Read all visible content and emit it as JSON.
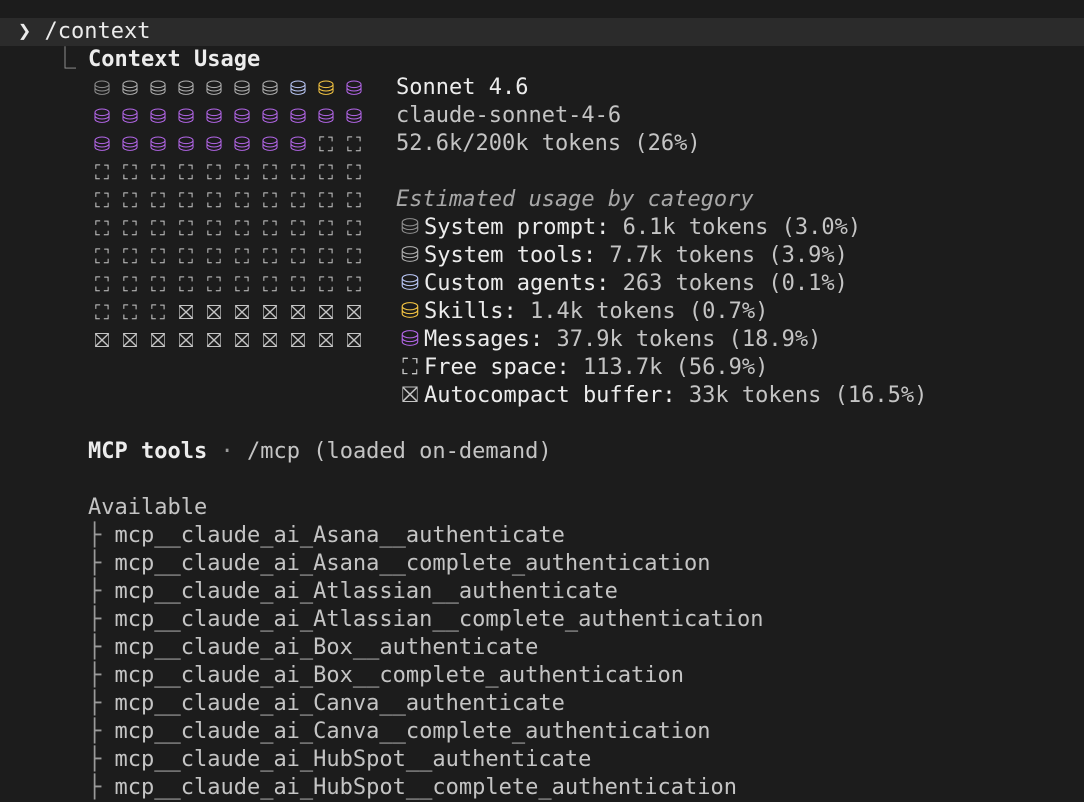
{
  "prompt": {
    "chevron": "❯",
    "command": "/context"
  },
  "panel": {
    "corner": "⎿",
    "title": "Context Usage"
  },
  "icons": {
    "system": "⛁",
    "free": "⛶",
    "buffer": "⛝",
    "names": {
      "system_prompt": "database-icon",
      "system_tools": "database-icon",
      "custom_agents": "database-icon",
      "skills": "database-icon",
      "messages": "database-icon",
      "free_space": "dashed-square-icon",
      "autocompact_buffer": "crossed-square-icon"
    }
  },
  "colors": {
    "system_prompt": "#8e8e8e",
    "system_tools": "#b0b0b0",
    "custom_agents": "#b9c6f5",
    "skills": "#f5c542",
    "messages": "#b366e8",
    "free_space": "#c4c4c4",
    "autocompact_buffer": "#c4c4c4"
  },
  "grid_rows": [
    [
      "system_prompt",
      "system_tools",
      "system_tools",
      "system_tools",
      "system_tools",
      "system_tools",
      "system_tools",
      "custom_agents",
      "skills",
      "messages"
    ],
    [
      "messages",
      "messages",
      "messages",
      "messages",
      "messages",
      "messages",
      "messages",
      "messages",
      "messages",
      "messages"
    ],
    [
      "messages",
      "messages",
      "messages",
      "messages",
      "messages",
      "messages",
      "messages",
      "messages",
      "free_space",
      "free_space"
    ],
    [
      "free_space",
      "free_space",
      "free_space",
      "free_space",
      "free_space",
      "free_space",
      "free_space",
      "free_space",
      "free_space",
      "free_space"
    ],
    [
      "free_space",
      "free_space",
      "free_space",
      "free_space",
      "free_space",
      "free_space",
      "free_space",
      "free_space",
      "free_space",
      "free_space"
    ],
    [
      "free_space",
      "free_space",
      "free_space",
      "free_space",
      "free_space",
      "free_space",
      "free_space",
      "free_space",
      "free_space",
      "free_space"
    ],
    [
      "free_space",
      "free_space",
      "free_space",
      "free_space",
      "free_space",
      "free_space",
      "free_space",
      "free_space",
      "free_space",
      "free_space"
    ],
    [
      "free_space",
      "free_space",
      "free_space",
      "free_space",
      "free_space",
      "free_space",
      "free_space",
      "free_space",
      "free_space",
      "free_space"
    ],
    [
      "free_space",
      "free_space",
      "free_space",
      "autocompact_buffer",
      "autocompact_buffer",
      "autocompact_buffer",
      "autocompact_buffer",
      "autocompact_buffer",
      "autocompact_buffer",
      "autocompact_buffer"
    ],
    [
      "autocompact_buffer",
      "autocompact_buffer",
      "autocompact_buffer",
      "autocompact_buffer",
      "autocompact_buffer",
      "autocompact_buffer",
      "autocompact_buffer",
      "autocompact_buffer",
      "autocompact_buffer",
      "autocompact_buffer"
    ]
  ],
  "model": {
    "name": "Sonnet 4.6",
    "id": "claude-sonnet-4-6",
    "tokens": "52.6k/200k tokens (26%)"
  },
  "estimated": {
    "heading": "Estimated usage by category",
    "items": [
      {
        "key": "system_prompt",
        "label": "System prompt:",
        "value": "6.1k tokens (3.0%)"
      },
      {
        "key": "system_tools",
        "label": "System tools:",
        "value": "7.7k tokens (3.9%)"
      },
      {
        "key": "custom_agents",
        "label": "Custom agents:",
        "value": "263 tokens (0.1%)"
      },
      {
        "key": "skills",
        "label": "Skills:",
        "value": "1.4k tokens (0.7%)"
      },
      {
        "key": "messages",
        "label": "Messages:",
        "value": "37.9k tokens (18.9%)"
      },
      {
        "key": "free_space",
        "label": "Free space:",
        "value": "113.7k (56.9%)"
      },
      {
        "key": "autocompact_buffer",
        "label": "Autocompact buffer:",
        "value": "33k tokens (16.5%)"
      }
    ]
  },
  "mcp": {
    "title": "MCP tools",
    "separator": "·",
    "command": "/mcp",
    "note": "(loaded on-demand)",
    "available_label": "Available",
    "branch": "├",
    "tools": [
      "mcp__claude_ai_Asana__authenticate",
      "mcp__claude_ai_Asana__complete_authentication",
      "mcp__claude_ai_Atlassian__authenticate",
      "mcp__claude_ai_Atlassian__complete_authentication",
      "mcp__claude_ai_Box__authenticate",
      "mcp__claude_ai_Box__complete_authentication",
      "mcp__claude_ai_Canva__authenticate",
      "mcp__claude_ai_Canva__complete_authentication",
      "mcp__claude_ai_HubSpot__authenticate",
      "mcp__claude_ai_HubSpot__complete_authentication"
    ]
  }
}
